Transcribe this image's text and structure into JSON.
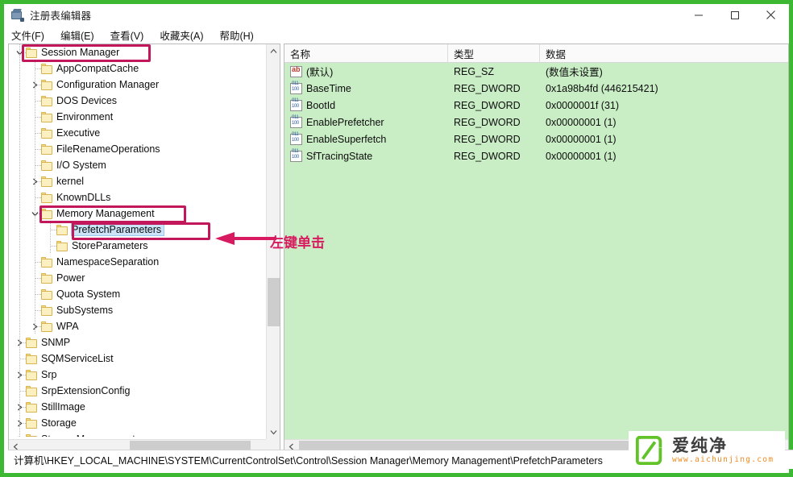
{
  "window": {
    "title": "注册表编辑器",
    "icon": "registry-editor-icon",
    "minimize_label": "–",
    "maximize_label": "□",
    "close_label": "✕"
  },
  "menubar": {
    "items": [
      {
        "label": "文件(F)",
        "name": "menu-file"
      },
      {
        "label": "编辑(E)",
        "name": "menu-edit"
      },
      {
        "label": "查看(V)",
        "name": "menu-view"
      },
      {
        "label": "收藏夹(A)",
        "name": "menu-favorites"
      },
      {
        "label": "帮助(H)",
        "name": "menu-help"
      }
    ]
  },
  "tree": {
    "items": [
      {
        "label": "Session Manager",
        "indent": 0,
        "twisty": "down",
        "selected": false
      },
      {
        "label": "AppCompatCache",
        "indent": 1,
        "twisty": "none",
        "selected": false
      },
      {
        "label": "Configuration Manager",
        "indent": 1,
        "twisty": "right",
        "selected": false
      },
      {
        "label": "DOS Devices",
        "indent": 1,
        "twisty": "none",
        "selected": false
      },
      {
        "label": "Environment",
        "indent": 1,
        "twisty": "none",
        "selected": false
      },
      {
        "label": "Executive",
        "indent": 1,
        "twisty": "none",
        "selected": false
      },
      {
        "label": "FileRenameOperations",
        "indent": 1,
        "twisty": "none",
        "selected": false
      },
      {
        "label": "I/O System",
        "indent": 1,
        "twisty": "none",
        "selected": false
      },
      {
        "label": "kernel",
        "indent": 1,
        "twisty": "right",
        "selected": false
      },
      {
        "label": "KnownDLLs",
        "indent": 1,
        "twisty": "none",
        "selected": false
      },
      {
        "label": "Memory Management",
        "indent": 1,
        "twisty": "down",
        "selected": false
      },
      {
        "label": "PrefetchParameters",
        "indent": 2,
        "twisty": "none",
        "selected": true
      },
      {
        "label": "StoreParameters",
        "indent": 2,
        "twisty": "none",
        "selected": false
      },
      {
        "label": "NamespaceSeparation",
        "indent": 1,
        "twisty": "none",
        "selected": false
      },
      {
        "label": "Power",
        "indent": 1,
        "twisty": "none",
        "selected": false
      },
      {
        "label": "Quota System",
        "indent": 1,
        "twisty": "none",
        "selected": false
      },
      {
        "label": "SubSystems",
        "indent": 1,
        "twisty": "none",
        "selected": false
      },
      {
        "label": "WPA",
        "indent": 1,
        "twisty": "right",
        "selected": false
      },
      {
        "label": "SNMP",
        "indent": 0,
        "twisty": "right",
        "selected": false
      },
      {
        "label": "SQMServiceList",
        "indent": 0,
        "twisty": "none",
        "selected": false
      },
      {
        "label": "Srp",
        "indent": 0,
        "twisty": "right",
        "selected": false
      },
      {
        "label": "SrpExtensionConfig",
        "indent": 0,
        "twisty": "none",
        "selected": false
      },
      {
        "label": "StillImage",
        "indent": 0,
        "twisty": "right",
        "selected": false
      },
      {
        "label": "Storage",
        "indent": 0,
        "twisty": "right",
        "selected": false
      },
      {
        "label": "StorageManagement",
        "indent": 0,
        "twisty": "right",
        "selected": false
      }
    ]
  },
  "list": {
    "columns": [
      {
        "label": "名称",
        "name": "column-name"
      },
      {
        "label": "类型",
        "name": "column-type"
      },
      {
        "label": "数据",
        "name": "column-data"
      }
    ],
    "rows": [
      {
        "name": "(默认)",
        "icon": "string-value-icon",
        "type": "REG_SZ",
        "data": "(数值未设置)"
      },
      {
        "name": "BaseTime",
        "icon": "dword-value-icon",
        "type": "REG_DWORD",
        "data": "0x1a98b4fd (446215421)"
      },
      {
        "name": "BootId",
        "icon": "dword-value-icon",
        "type": "REG_DWORD",
        "data": "0x0000001f (31)"
      },
      {
        "name": "EnablePrefetcher",
        "icon": "dword-value-icon",
        "type": "REG_DWORD",
        "data": "0x00000001 (1)"
      },
      {
        "name": "EnableSuperfetch",
        "icon": "dword-value-icon",
        "type": "REG_DWORD",
        "data": "0x00000001 (1)"
      },
      {
        "name": "SfTracingState",
        "icon": "dword-value-icon",
        "type": "REG_DWORD",
        "data": "0x00000001 (1)"
      }
    ]
  },
  "statusbar": {
    "path": "计算机\\HKEY_LOCAL_MACHINE\\SYSTEM\\CurrentControlSet\\Control\\Session Manager\\Memory Management\\PrefetchParameters"
  },
  "annotation": {
    "text": "左键单击",
    "color": "#d81b60"
  },
  "watermark": {
    "brand": "爱纯净",
    "url": "www.aichunjing.com",
    "logo_color": "#62c329",
    "url_color": "#f08a1e"
  },
  "colors": {
    "window_border": "#3cb832",
    "list_background": "#c9edc5",
    "selection": "#cce4f7",
    "annotation": "#c2185b"
  }
}
